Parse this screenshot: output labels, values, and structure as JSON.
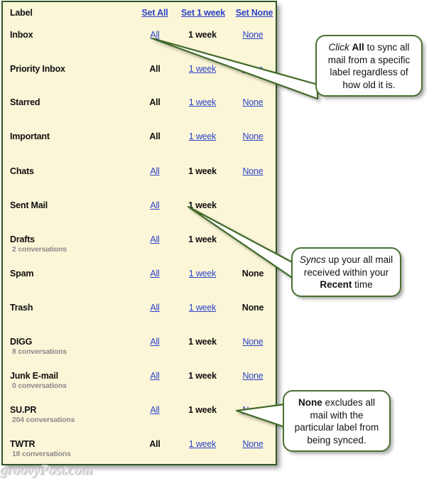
{
  "panel": {
    "header": {
      "label_col": "Label",
      "set_all": "Set All",
      "set_week": "Set 1 week",
      "set_none": "Set None"
    },
    "options": {
      "all": "All",
      "week": "1 week",
      "none": "None"
    },
    "rows": [
      {
        "label": "Inbox",
        "sub": "",
        "all": "All",
        "week": "1 week",
        "none": "None",
        "selected": "week",
        "show_none": true
      },
      {
        "label": "Priority Inbox",
        "sub": "",
        "all": "All",
        "week": "1 week",
        "none": "None",
        "selected": "all",
        "show_none": true
      },
      {
        "label": "Starred",
        "sub": "",
        "all": "All",
        "week": "1 week",
        "none": "None",
        "selected": "all",
        "show_none": true
      },
      {
        "label": "Important",
        "sub": "",
        "all": "All",
        "week": "1 week",
        "none": "None",
        "selected": "all",
        "show_none": true
      },
      {
        "label": "Chats",
        "sub": "",
        "all": "All",
        "week": "1 week",
        "none": "None",
        "selected": "week",
        "show_none": true
      },
      {
        "label": "Sent Mail",
        "sub": "",
        "all": "All",
        "week": "1 week",
        "none": "",
        "selected": "week",
        "show_none": false
      },
      {
        "label": "Drafts",
        "sub": "2 conversations",
        "all": "All",
        "week": "1 week",
        "none": "",
        "selected": "week",
        "show_none": false
      },
      {
        "label": "Spam",
        "sub": "",
        "all": "All",
        "week": "1 week",
        "none": "None",
        "selected": "none",
        "show_none": true
      },
      {
        "label": "Trash",
        "sub": "",
        "all": "All",
        "week": "1 week",
        "none": "None",
        "selected": "none",
        "show_none": true
      },
      {
        "label": "DIGG",
        "sub": "8 conversations",
        "all": "All",
        "week": "1 week",
        "none": "None",
        "selected": "week",
        "show_none": true
      },
      {
        "label": "Junk E-mail",
        "sub": "0 conversations",
        "all": "All",
        "week": "1 week",
        "none": "None",
        "selected": "week",
        "show_none": true
      },
      {
        "label": "SU.PR",
        "sub": "204 conversations",
        "all": "All",
        "week": "1 week",
        "none": "None",
        "selected": "week",
        "show_none": true
      },
      {
        "label": "TWTR",
        "sub": "18 conversations",
        "all": "All",
        "week": "1 week",
        "none": "None",
        "selected": "all",
        "show_none": true
      }
    ]
  },
  "callouts": {
    "all": {
      "line1_italic": "Click",
      "line1_bold": "All",
      "text": " to sync all mail from a specific label regardless of how old it is."
    },
    "week": {
      "lead_italic": "Syncs",
      "mid": " up your all mail received within your ",
      "bold": "Recent",
      "tail": " time"
    },
    "none": {
      "bold": "None",
      "text": " excludes all mail with the particular label from being synced."
    }
  },
  "watermark": "groovyPost.com",
  "colors": {
    "panel_bg": "#fcf6d8",
    "panel_border": "#2f5624",
    "link": "#2b43c8",
    "callout_border": "#4a7030",
    "pointer": "#3f6a28",
    "subtext": "#8a8a8a"
  }
}
